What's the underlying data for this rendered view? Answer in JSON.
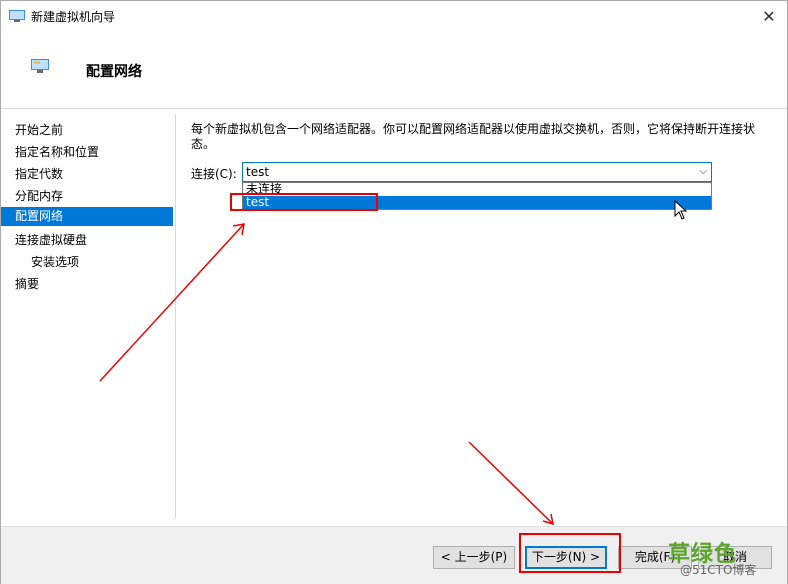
{
  "window": {
    "title": "新建虚拟机向导"
  },
  "header": {
    "title": "配置网络"
  },
  "sidebar": {
    "items": [
      {
        "label": "开始之前",
        "active": false,
        "sub": false
      },
      {
        "label": "指定名称和位置",
        "active": false,
        "sub": false
      },
      {
        "label": "指定代数",
        "active": false,
        "sub": false
      },
      {
        "label": "分配内存",
        "active": false,
        "sub": false
      },
      {
        "label": "配置网络",
        "active": true,
        "sub": false
      },
      {
        "label": "连接虚拟硬盘",
        "active": false,
        "sub": false
      },
      {
        "label": "安装选项",
        "active": false,
        "sub": true
      },
      {
        "label": "摘要",
        "active": false,
        "sub": false
      }
    ]
  },
  "main": {
    "description": "每个新虚拟机包含一个网络适配器。你可以配置网络适配器以使用虚拟交换机，否则，它将保持断开连接状态。",
    "connection_label": "连接(C):",
    "connection_value": "test",
    "dropdown_options": [
      "未连接",
      "test"
    ],
    "selected_option": "test"
  },
  "footer": {
    "prev_label": "< 上一步(P)",
    "next_label": "下一步(N) >",
    "finish_label": "完成(F)",
    "cancel_label": "取消"
  },
  "watermark": {
    "main": "草绿色",
    "sub": "@51CTO博客"
  },
  "colors": {
    "accent": "#0078d7",
    "annotation": "#ee0000",
    "watermark": "#5aa52c"
  }
}
